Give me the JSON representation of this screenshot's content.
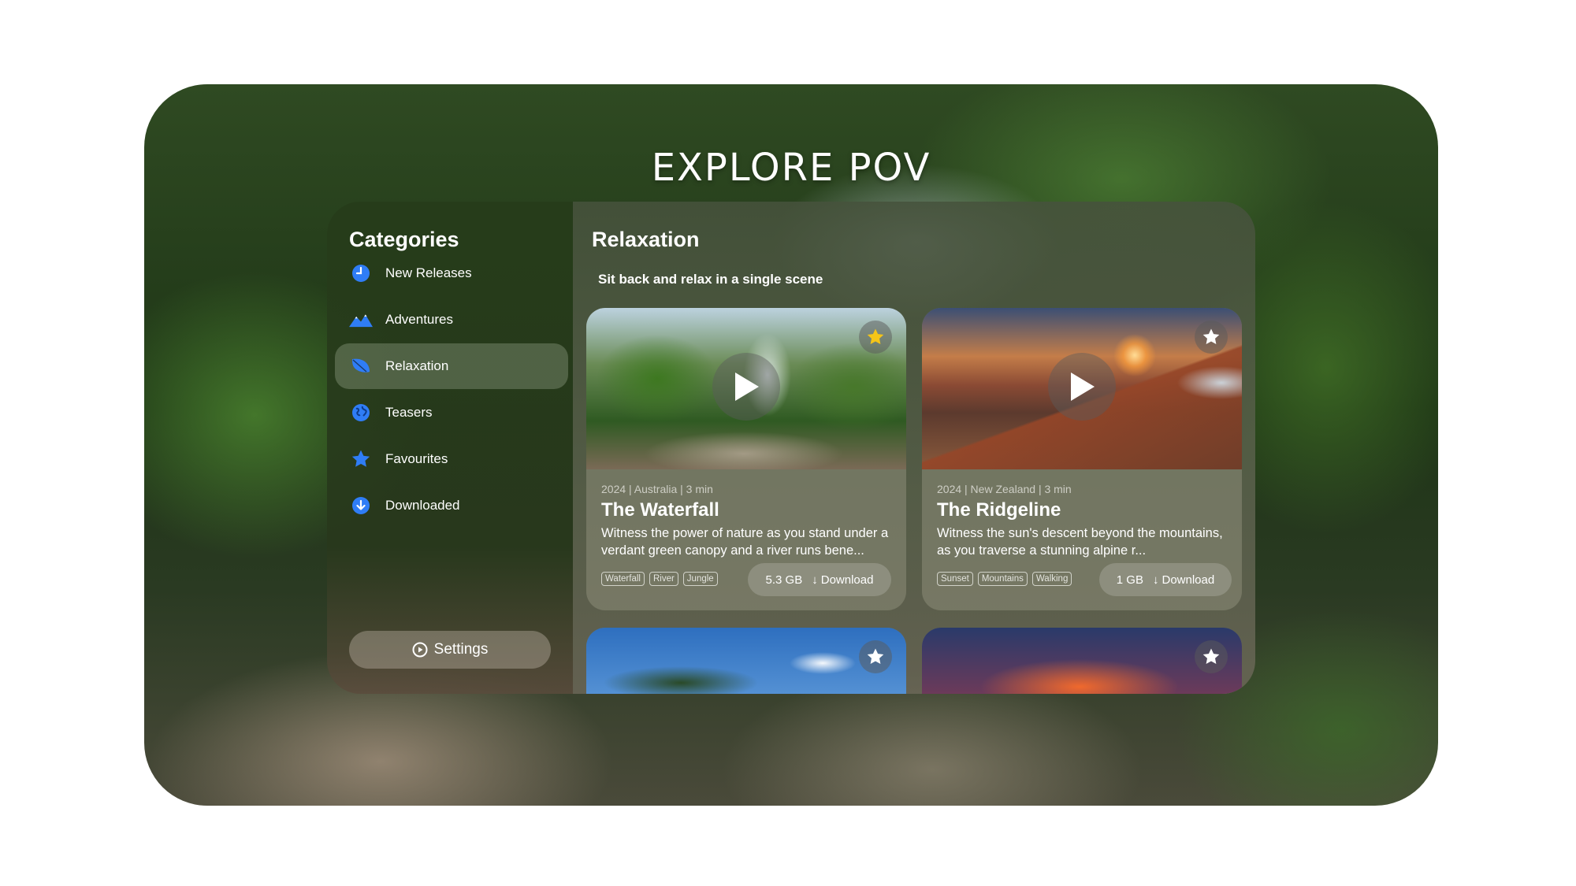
{
  "app": {
    "logo_text": "EXPLORE POV"
  },
  "sidebar": {
    "title": "Categories",
    "items": [
      {
        "label": "New Releases",
        "icon": "clock-icon",
        "active": false
      },
      {
        "label": "Adventures",
        "icon": "mountains-icon",
        "active": false
      },
      {
        "label": "Relaxation",
        "icon": "leaf-icon",
        "active": true
      },
      {
        "label": "Teasers",
        "icon": "globe-icon",
        "active": false
      },
      {
        "label": "Favourites",
        "icon": "star-icon",
        "active": false
      },
      {
        "label": "Downloaded",
        "icon": "download-circle-icon",
        "active": false
      }
    ],
    "settings_label": "Settings"
  },
  "main": {
    "title": "Relaxation",
    "subtitle": "Sit back and relax in a single scene",
    "cards": [
      {
        "meta": "2024 | Australia | 3 min",
        "title": "The Waterfall",
        "description": "Witness the power of nature as you stand under a verdant green canopy and a river runs bene...",
        "tags": [
          "Waterfall",
          "River",
          "Jungle"
        ],
        "size": "5.3 GB",
        "download_label": "Download",
        "favourite": true
      },
      {
        "meta": "2024 | New Zealand | 3 min",
        "title": "The Ridgeline",
        "description": "Witness the sun's descent beyond the mountains, as you traverse a stunning alpine r...",
        "tags": [
          "Sunset",
          "Mountains",
          "Walking"
        ],
        "size": "1 GB",
        "download_label": "Download",
        "favourite": false
      }
    ]
  },
  "colors": {
    "accent": "#2f7df6",
    "favourite_star": "#f5c518",
    "star_inactive": "#ffffff"
  }
}
